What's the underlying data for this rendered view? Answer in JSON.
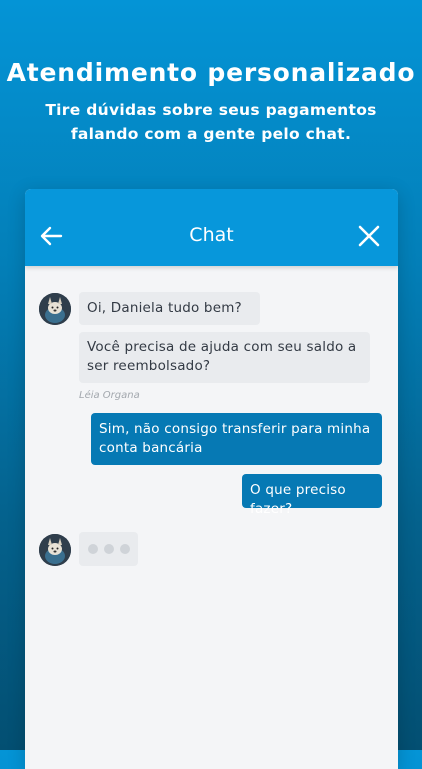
{
  "hero": {
    "title": "Atendimento personalizado",
    "subtitle": "Tire dúvidas sobre seus pagamentos falando com a gente pelo chat."
  },
  "chat": {
    "title": "Chat",
    "back_icon": "arrow-left-icon",
    "close_icon": "close-icon",
    "agent_name": "Léia Organa",
    "messages": [
      {
        "from": "agent",
        "text": "Oi, Daniela tudo bem?"
      },
      {
        "from": "agent",
        "text": "Você precisa de ajuda com seu saldo a ser reembolsado?"
      },
      {
        "from": "user",
        "text": "Sim, não consigo transferir para minha conta bancária"
      },
      {
        "from": "user",
        "text": "O que preciso fazer?"
      }
    ],
    "typing_indicator": "typing-dots"
  },
  "colors": {
    "header": "#0797db",
    "user_bubble": "#0679b4",
    "agent_bubble": "#e9ebee",
    "background_top": "#0494d6",
    "background_bottom": "#034f72"
  }
}
